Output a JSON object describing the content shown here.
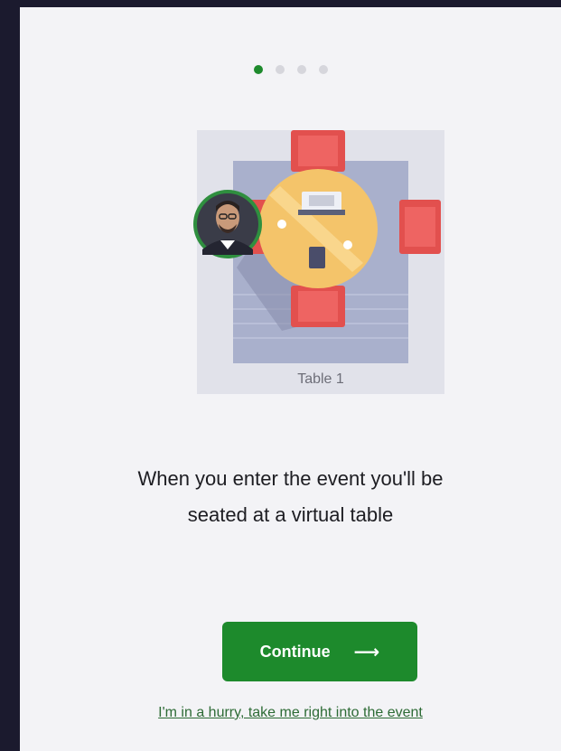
{
  "onboarding": {
    "steps_total": 4,
    "current_step": 1,
    "table_label": "Table 1",
    "headline_line1": "When you enter the event you'll be",
    "headline_line2": "seated at a virtual table",
    "continue_label": "Continue",
    "continue_icon": "arrow-right-icon",
    "skip_link": "I'm in a hurry, take me right into the event"
  },
  "colors": {
    "accent": "#1d8a2c",
    "chair": "#e2504e",
    "table": "#f4c46a",
    "background": "#f3f3f6",
    "outer": "#1b1a2e"
  }
}
